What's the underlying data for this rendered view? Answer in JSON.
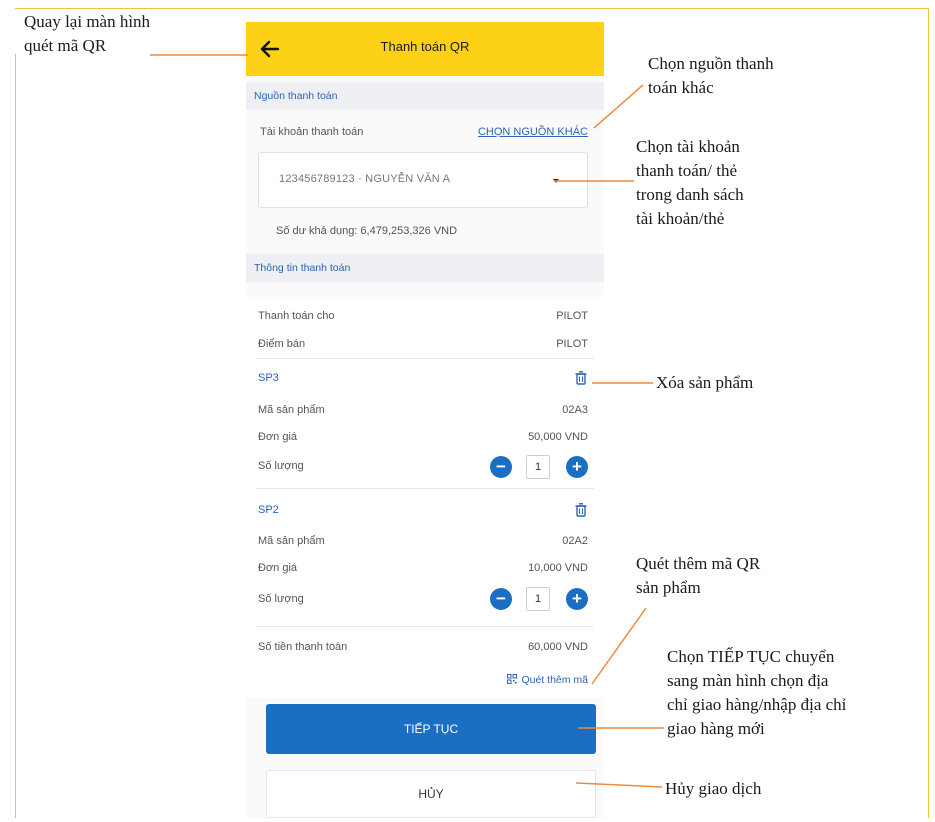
{
  "appbar": {
    "title": "Thanh toán QR",
    "back_icon": "arrow-left-icon"
  },
  "payment_source": {
    "section_title": "Nguồn thanh toán",
    "account_label": "Tài khoản thanh toán",
    "choose_other_link": "CHỌN NGUỒN KHÁC",
    "selected_account": "123456789123 · NGUYỄN VĂN A",
    "balance": "Số dư khả dụng: 6,479,253,326 VND"
  },
  "payment_info": {
    "section_title": "Thông tin thanh toán",
    "pay_to_label": "Thanh toán cho",
    "pay_to_value": "PILOT",
    "point_of_sale_label": "Điểm bán",
    "point_of_sale_value": "PILOT"
  },
  "products": [
    {
      "name": "SP3",
      "code_label": "Mã sản phẩm",
      "code": "02A3",
      "price_label": "Đơn giá",
      "price": "50,000 VND",
      "qty_label": "Số lượng",
      "qty": "1"
    },
    {
      "name": "SP2",
      "code_label": "Mã sản phẩm",
      "code": "02A2",
      "price_label": "Đơn giá",
      "price": "10,000 VND",
      "qty_label": "Số lượng",
      "qty": "1"
    }
  ],
  "total": {
    "label": "Số tiền thanh toán",
    "value": "60,000 VND"
  },
  "scan_more_label": "Quét thêm mã",
  "continue_label": "TIẾP TỤC",
  "cancel_label": "HỦY",
  "annotations": {
    "back": [
      "Quay lại màn hình",
      "quét mã QR"
    ],
    "choose_source": [
      "Chọn nguồn thanh",
      "toán khác"
    ],
    "choose_account": [
      "Chọn tài khoản",
      "thanh toán/ thẻ",
      "trong danh sách",
      "tài khoản/thẻ"
    ],
    "delete_product": [
      "Xóa sản phẩm"
    ],
    "scan_more": [
      "Quét thêm mã QR",
      "sản phẩm"
    ],
    "continue": [
      "Chọn TIẾP TỤC chuyển",
      "sang màn hình chọn địa",
      "chỉ giao hàng/nhập địa chỉ",
      "giao hàng mới"
    ],
    "cancel": [
      "Hủy giao dịch"
    ]
  },
  "colors": {
    "appbar": "#fcd116",
    "primary": "#1a6fc4",
    "link": "#2a63b8",
    "frame": "#f0c23a"
  }
}
